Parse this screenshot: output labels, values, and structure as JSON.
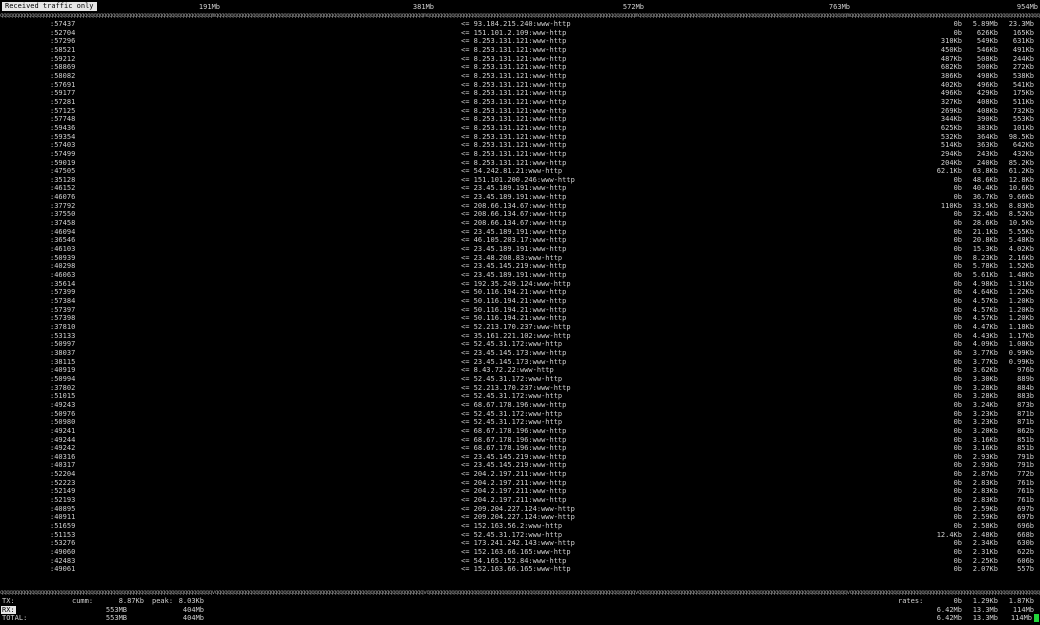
{
  "header": {
    "filter_badge": "Received traffic only",
    "scale_ticks": [
      "191Mb",
      "381Mb",
      "572Mb",
      "763Mb",
      "954Mb"
    ]
  },
  "divider_char": "q",
  "divider_top_marks": "m",
  "divider_bottom_marks": "v",
  "connections": [
    {
      "src": ":57437",
      "dst": "<= 93.184.215.240:www-http",
      "r2": "0b",
      "r10": "5.89Mb",
      "r40": "23.3Mb"
    },
    {
      "src": ":52704",
      "dst": "<= 151.101.2.109:www-http",
      "r2": "0b",
      "r10": "626Kb",
      "r40": "165Kb"
    },
    {
      "src": ":57296",
      "dst": "<= 8.253.131.121:www-http",
      "r2": "310Kb",
      "r10": "549Kb",
      "r40": "631Kb"
    },
    {
      "src": ":58521",
      "dst": "<= 8.253.131.121:www-http",
      "r2": "450Kb",
      "r10": "546Kb",
      "r40": "491Kb"
    },
    {
      "src": ":59212",
      "dst": "<= 8.253.131.121:www-http",
      "r2": "487Kb",
      "r10": "508Kb",
      "r40": "244Kb"
    },
    {
      "src": ":58869",
      "dst": "<= 8.253.131.121:www-http",
      "r2": "682Kb",
      "r10": "500Kb",
      "r40": "272Kb"
    },
    {
      "src": ":58082",
      "dst": "<= 8.253.131.121:www-http",
      "r2": "386Kb",
      "r10": "498Kb",
      "r40": "538Kb"
    },
    {
      "src": ":57691",
      "dst": "<= 8.253.131.121:www-http",
      "r2": "402Kb",
      "r10": "496Kb",
      "r40": "541Kb"
    },
    {
      "src": ":59177",
      "dst": "<= 8.253.131.121:www-http",
      "r2": "496Kb",
      "r10": "429Kb",
      "r40": "175Kb"
    },
    {
      "src": ":57281",
      "dst": "<= 8.253.131.121:www-http",
      "r2": "327Kb",
      "r10": "408Kb",
      "r40": "511Kb"
    },
    {
      "src": ":57125",
      "dst": "<= 8.253.131.121:www-http",
      "r2": "269Kb",
      "r10": "408Kb",
      "r40": "732Kb"
    },
    {
      "src": ":57748",
      "dst": "<= 8.253.131.121:www-http",
      "r2": "344Kb",
      "r10": "390Kb",
      "r40": "553Kb"
    },
    {
      "src": ":59436",
      "dst": "<= 8.253.131.121:www-http",
      "r2": "625Kb",
      "r10": "383Kb",
      "r40": "101Kb"
    },
    {
      "src": ":59354",
      "dst": "<= 8.253.131.121:www-http",
      "r2": "532Kb",
      "r10": "364Kb",
      "r40": "98.5Kb"
    },
    {
      "src": ":57403",
      "dst": "<= 8.253.131.121:www-http",
      "r2": "514Kb",
      "r10": "363Kb",
      "r40": "642Kb"
    },
    {
      "src": ":57499",
      "dst": "<= 8.253.131.121:www-http",
      "r2": "294Kb",
      "r10": "243Kb",
      "r40": "432Kb"
    },
    {
      "src": ":59019",
      "dst": "<= 8.253.131.121:www-http",
      "r2": "204Kb",
      "r10": "240Kb",
      "r40": "85.2Kb"
    },
    {
      "src": ":47505",
      "dst": "<= 54.242.81.21:www-http",
      "r2": "62.1Kb",
      "r10": "63.8Kb",
      "r40": "61.2Kb"
    },
    {
      "src": ":35128",
      "dst": "<= 151.101.200.246:www-http",
      "r2": "0b",
      "r10": "48.6Kb",
      "r40": "12.8Kb"
    },
    {
      "src": ":46152",
      "dst": "<= 23.45.189.191:www-http",
      "r2": "0b",
      "r10": "40.4Kb",
      "r40": "10.6Kb"
    },
    {
      "src": ":46076",
      "dst": "<= 23.45.189.191:www-http",
      "r2": "0b",
      "r10": "36.7Kb",
      "r40": "9.66Kb"
    },
    {
      "src": ":37792",
      "dst": "<= 208.66.134.67:www-http",
      "r2": "110Kb",
      "r10": "33.5Kb",
      "r40": "8.83Kb"
    },
    {
      "src": ":37550",
      "dst": "<= 208.66.134.67:www-http",
      "r2": "0b",
      "r10": "32.4Kb",
      "r40": "8.52Kb"
    },
    {
      "src": ":37458",
      "dst": "<= 208.66.134.67:www-http",
      "r2": "0b",
      "r10": "28.6Kb",
      "r40": "10.5Kb"
    },
    {
      "src": ":46094",
      "dst": "<= 23.45.189.191:www-http",
      "r2": "0b",
      "r10": "21.1Kb",
      "r40": "5.55Kb"
    },
    {
      "src": ":36546",
      "dst": "<= 46.105.203.17:www-http",
      "r2": "0b",
      "r10": "20.8Kb",
      "r40": "5.48Kb"
    },
    {
      "src": ":46103",
      "dst": "<= 23.45.189.191:www-http",
      "r2": "0b",
      "r10": "15.3Kb",
      "r40": "4.02Kb"
    },
    {
      "src": ":50939",
      "dst": "<= 23.48.208.83:www-http",
      "r2": "0b",
      "r10": "8.23Kb",
      "r40": "2.16Kb"
    },
    {
      "src": ":40298",
      "dst": "<= 23.45.145.219:www-http",
      "r2": "0b",
      "r10": "5.78Kb",
      "r40": "1.52Kb"
    },
    {
      "src": ":46063",
      "dst": "<= 23.45.189.191:www-http",
      "r2": "0b",
      "r10": "5.61Kb",
      "r40": "1.48Kb"
    },
    {
      "src": ":35614",
      "dst": "<= 192.35.249.124:www-http",
      "r2": "0b",
      "r10": "4.98Kb",
      "r40": "1.31Kb"
    },
    {
      "src": ":57399",
      "dst": "<= 50.116.194.21:www-http",
      "r2": "0b",
      "r10": "4.64Kb",
      "r40": "1.22Kb"
    },
    {
      "src": ":57384",
      "dst": "<= 50.116.194.21:www-http",
      "r2": "0b",
      "r10": "4.57Kb",
      "r40": "1.20Kb"
    },
    {
      "src": ":57397",
      "dst": "<= 50.116.194.21:www-http",
      "r2": "0b",
      "r10": "4.57Kb",
      "r40": "1.20Kb"
    },
    {
      "src": ":57398",
      "dst": "<= 50.116.194.21:www-http",
      "r2": "0b",
      "r10": "4.57Kb",
      "r40": "1.20Kb"
    },
    {
      "src": ":37810",
      "dst": "<= 52.213.170.237:www-http",
      "r2": "0b",
      "r10": "4.47Kb",
      "r40": "1.18Kb"
    },
    {
      "src": ":53133",
      "dst": "<= 35.161.221.102:www-http",
      "r2": "0b",
      "r10": "4.43Kb",
      "r40": "1.17Kb"
    },
    {
      "src": ":50997",
      "dst": "<= 52.45.31.172:www-http",
      "r2": "0b",
      "r10": "4.09Kb",
      "r40": "1.08Kb"
    },
    {
      "src": ":38037",
      "dst": "<= 23.45.145.173:www-http",
      "r2": "0b",
      "r10": "3.77Kb",
      "r40": "0.99Kb"
    },
    {
      "src": ":38115",
      "dst": "<= 23.45.145.173:www-http",
      "r2": "0b",
      "r10": "3.77Kb",
      "r40": "0.99Kb"
    },
    {
      "src": ":40919",
      "dst": "<= 8.43.72.22:www-http",
      "r2": "0b",
      "r10": "3.62Kb",
      "r40": "976b"
    },
    {
      "src": ":50994",
      "dst": "<= 52.45.31.172:www-http",
      "r2": "0b",
      "r10": "3.30Kb",
      "r40": "889b"
    },
    {
      "src": ":37802",
      "dst": "<= 52.213.170.237:www-http",
      "r2": "0b",
      "r10": "3.28Kb",
      "r40": "884b"
    },
    {
      "src": ":51015",
      "dst": "<= 52.45.31.172:www-http",
      "r2": "0b",
      "r10": "3.28Kb",
      "r40": "883b"
    },
    {
      "src": ":49243",
      "dst": "<= 68.67.178.196:www-http",
      "r2": "0b",
      "r10": "3.24Kb",
      "r40": "873b"
    },
    {
      "src": ":50976",
      "dst": "<= 52.45.31.172:www-http",
      "r2": "0b",
      "r10": "3.23Kb",
      "r40": "871b"
    },
    {
      "src": ":50980",
      "dst": "<= 52.45.31.172:www-http",
      "r2": "0b",
      "r10": "3.23Kb",
      "r40": "871b"
    },
    {
      "src": ":49241",
      "dst": "<= 68.67.178.196:www-http",
      "r2": "0b",
      "r10": "3.20Kb",
      "r40": "862b"
    },
    {
      "src": ":49244",
      "dst": "<= 68.67.178.196:www-http",
      "r2": "0b",
      "r10": "3.16Kb",
      "r40": "851b"
    },
    {
      "src": ":49242",
      "dst": "<= 68.67.178.196:www-http",
      "r2": "0b",
      "r10": "3.16Kb",
      "r40": "851b"
    },
    {
      "src": ":40316",
      "dst": "<= 23.45.145.219:www-http",
      "r2": "0b",
      "r10": "2.93Kb",
      "r40": "791b"
    },
    {
      "src": ":40317",
      "dst": "<= 23.45.145.219:www-http",
      "r2": "0b",
      "r10": "2.93Kb",
      "r40": "791b"
    },
    {
      "src": ":52204",
      "dst": "<= 204.2.197.211:www-http",
      "r2": "0b",
      "r10": "2.87Kb",
      "r40": "772b"
    },
    {
      "src": ":52223",
      "dst": "<= 204.2.197.211:www-http",
      "r2": "0b",
      "r10": "2.83Kb",
      "r40": "761b"
    },
    {
      "src": ":52149",
      "dst": "<= 204.2.197.211:www-http",
      "r2": "0b",
      "r10": "2.83Kb",
      "r40": "761b"
    },
    {
      "src": ":52193",
      "dst": "<= 204.2.197.211:www-http",
      "r2": "0b",
      "r10": "2.83Kb",
      "r40": "761b"
    },
    {
      "src": ":40895",
      "dst": "<= 209.204.227.124:www-http",
      "r2": "0b",
      "r10": "2.59Kb",
      "r40": "697b"
    },
    {
      "src": ":40911",
      "dst": "<= 209.204.227.124:www-http",
      "r2": "0b",
      "r10": "2.59Kb",
      "r40": "697b"
    },
    {
      "src": ":51659",
      "dst": "<= 152.163.56.2:www-http",
      "r2": "0b",
      "r10": "2.58Kb",
      "r40": "696b"
    },
    {
      "src": ":51153",
      "dst": "<= 52.45.31.172:www-http",
      "r2": "12.4Kb",
      "r10": "2.48Kb",
      "r40": "668b"
    },
    {
      "src": ":53276",
      "dst": "<= 173.241.242.143:www-http",
      "r2": "0b",
      "r10": "2.34Kb",
      "r40": "630b"
    },
    {
      "src": ":49060",
      "dst": "<= 152.163.66.165:www-http",
      "r2": "0b",
      "r10": "2.31Kb",
      "r40": "622b"
    },
    {
      "src": ":42483",
      "dst": "<= 54.165.152.84:www-http",
      "r2": "0b",
      "r10": "2.25Kb",
      "r40": "606b"
    },
    {
      "src": ":49061",
      "dst": "<= 152.163.66.165:www-http",
      "r2": "0b",
      "r10": "2.07Kb",
      "r40": "557b"
    }
  ],
  "totals": {
    "tx": {
      "label": "TX:",
      "cumm_label": "cumm:",
      "cumm": "8.87Kb",
      "peak_label": "peak:",
      "peak": "8.03Kb",
      "rates_label": "rates:",
      "r2": "0b",
      "r10": "1.29Kb",
      "r40": "1.87Kb"
    },
    "rx": {
      "label": "RX:",
      "cumm": "553MB",
      "peak": "404Mb",
      "r2": "6.42Mb",
      "r10": "13.3Mb",
      "r40": "114Mb"
    },
    "total": {
      "label": "TOTAL:",
      "cumm": "553MB",
      "peak": "404Mb",
      "r2": "6.42Mb",
      "r10": "13.3Mb",
      "r40": "114Mb"
    }
  },
  "colors": {
    "background": "#000000",
    "text": "#cfcfcf",
    "badge_bg": "#e6e6e6",
    "cursor": "#22d63a"
  }
}
